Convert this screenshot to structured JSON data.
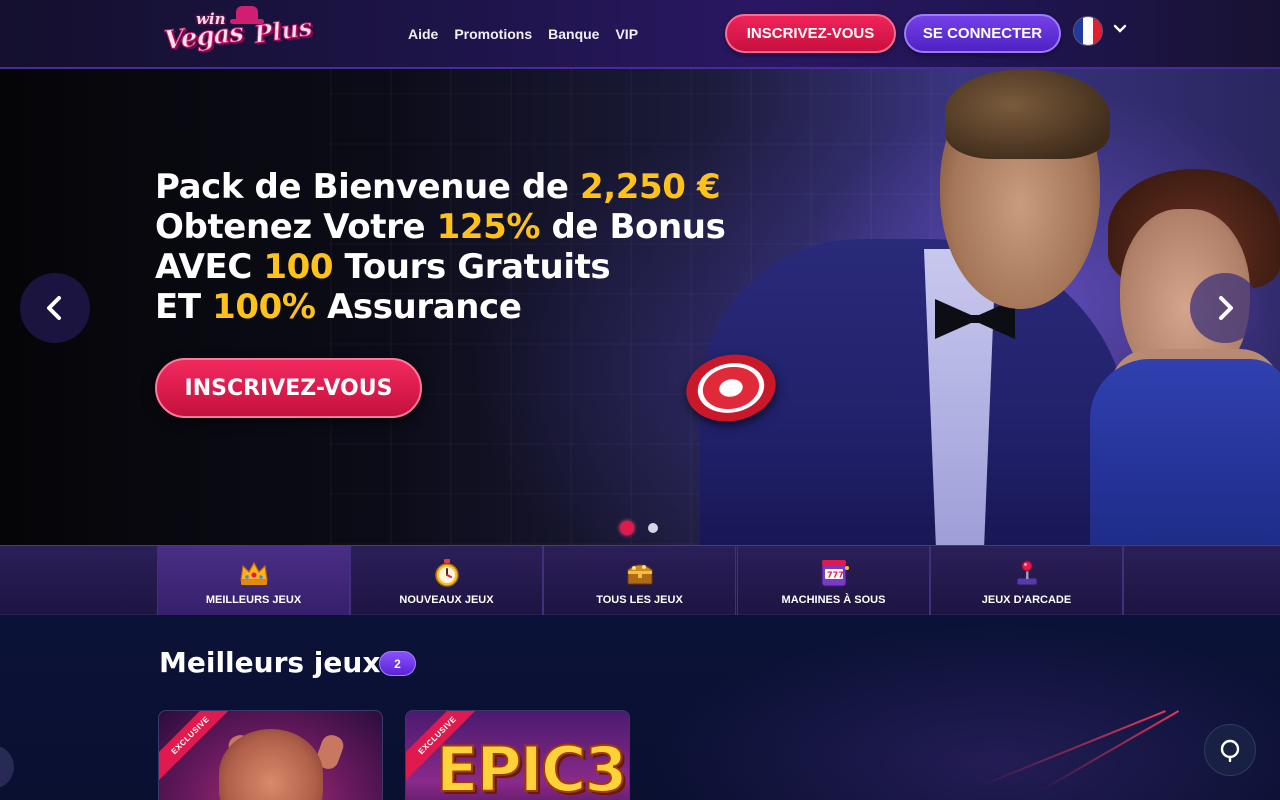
{
  "brand": {
    "logo_small": "win",
    "logo_main": "Vegas",
    "logo_plus": "Plus"
  },
  "nav": {
    "items": [
      {
        "label": "Aide"
      },
      {
        "label": "Promotions"
      },
      {
        "label": "Banque"
      },
      {
        "label": "VIP"
      }
    ]
  },
  "header": {
    "signup_label": "INSCRIVEZ-VOUS",
    "login_label": "SE CONNECTER",
    "language_flag": "france-flag-icon",
    "language_colors": [
      "#1f3b9c",
      "#ffffff",
      "#e4202e"
    ]
  },
  "hero": {
    "line1_pre": "Pack de Bienvenue de ",
    "line1_hl": "2,250 €",
    "line2_pre": "Obtenez Votre ",
    "line2_hl": "125%",
    "line2_post": " de Bonus",
    "line3_pre": "AVEC ",
    "line3_hl": "100",
    "line3_post": " Tours Gratuits",
    "line4_pre": "ET ",
    "line4_hl": "100%",
    "line4_post": " Assurance",
    "cta_label": "INSCRIVEZ-VOUS",
    "slides_total": 2,
    "active_slide": 1
  },
  "tabs": [
    {
      "label": "MEILLEURS JEUX",
      "icon": "crown-icon",
      "active": true
    },
    {
      "label": "NOUVEAUX JEUX",
      "icon": "stopwatch-icon",
      "active": false
    },
    {
      "label": "TOUS LES JEUX",
      "icon": "treasure-chest-icon",
      "active": false
    },
    {
      "label": "MACHINES À SOUS",
      "icon": "slot-machine-icon",
      "active": false
    },
    {
      "label": "JEUX D'ARCADE",
      "icon": "joystick-icon",
      "active": false
    }
  ],
  "section": {
    "title": "Meilleurs jeux",
    "count": "2"
  },
  "games": [
    {
      "ribbon": "EXCLUSIVE"
    },
    {
      "ribbon": "EXCLUSIVE",
      "title": "EPIC3"
    }
  ],
  "colors": {
    "accent_red": "#e0194f",
    "accent_purple": "#5a24d6",
    "highlight_gold": "#ffc21a"
  }
}
